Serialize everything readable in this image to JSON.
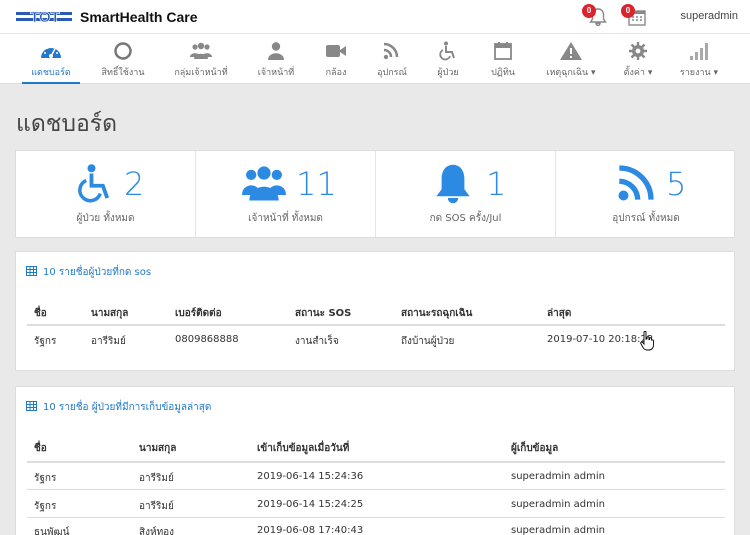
{
  "header": {
    "logo_text": "TOT",
    "brand": "SmartHealth Care",
    "notifications": [
      {
        "icon": "bell-icon",
        "count": "0"
      },
      {
        "icon": "calendar-icon",
        "count": "0"
      }
    ],
    "user": "superadmin"
  },
  "nav": {
    "items": [
      {
        "label": "แดชบอร์ด",
        "icon": "dashboard-icon",
        "active": true
      },
      {
        "label": "สิทธิ์ใช้งาน",
        "icon": "circle-icon"
      },
      {
        "label": "กลุ่มเจ้าหน้าที่",
        "icon": "users-icon"
      },
      {
        "label": "เจ้าหน้าที่",
        "icon": "user-icon"
      },
      {
        "label": "กล้อง",
        "icon": "video-icon"
      },
      {
        "label": "อุปกรณ์",
        "icon": "rss-icon"
      },
      {
        "label": "ผู้ป่วย",
        "icon": "wheelchair-icon"
      },
      {
        "label": "ปฏิทิน",
        "icon": "calendar-icon"
      },
      {
        "label": "เหตุฉุกเฉิน ▾",
        "icon": "warning-icon"
      },
      {
        "label": "ตั้งค่า ▾",
        "icon": "gear-icon"
      },
      {
        "label": "รายงาน ▾",
        "icon": "signal-icon"
      }
    ]
  },
  "page": {
    "title": "แดชบอร์ด"
  },
  "stats": [
    {
      "icon": "wheelchair-icon",
      "value": "2",
      "label": "ผู้ป่วย ทั้งหมด"
    },
    {
      "icon": "users-icon",
      "value": "11",
      "label": "เจ้าหน้าที่ ทั้งหมด"
    },
    {
      "icon": "bell-icon",
      "value": "1",
      "label": "กด SOS ครั้ง/Jul"
    },
    {
      "icon": "rss-icon",
      "value": "5",
      "label": "อุปกรณ์ ทั้งหมด"
    }
  ],
  "sos_panel": {
    "title": "10 รายชื่อผู้ป่วยที่กด sos",
    "columns": [
      "ชื่อ",
      "นามสกุล",
      "เบอร์ติดต่อ",
      "สถานะ SOS",
      "สถานะรถฉุกเฉิน",
      "ล่าสุด"
    ],
    "rows": [
      [
        "รัฐกร",
        "อารีริมย์",
        "0809868888",
        "งานสำเร็จ",
        "ถึงบ้านผู้ป่วย",
        "2019-07-10 20:18:22"
      ]
    ]
  },
  "data_panel": {
    "title": "10 รายชื่อ ผู้ป่วยที่มีการเก็บข้อมูลล่าสุด",
    "columns": [
      "ชื่อ",
      "นามสกุล",
      "เข้าเก็บข้อมูลเมื่อวันที่",
      "ผู้เก็บข้อมูล"
    ],
    "rows": [
      [
        "รัฐกร",
        "อารีริมย์",
        "2019-06-14 15:24:36",
        "superadmin admin"
      ],
      [
        "รัฐกร",
        "อารีริมย์",
        "2019-06-14 15:24:25",
        "superadmin admin"
      ],
      [
        "ธนพัฒน์",
        "สิงห์ทอง",
        "2019-06-08 17:40:43",
        "superadmin admin"
      ]
    ]
  },
  "colors": {
    "accent": "#2279c9",
    "stat_blue": "#2d8ae2",
    "badge_red": "#d9232d"
  }
}
